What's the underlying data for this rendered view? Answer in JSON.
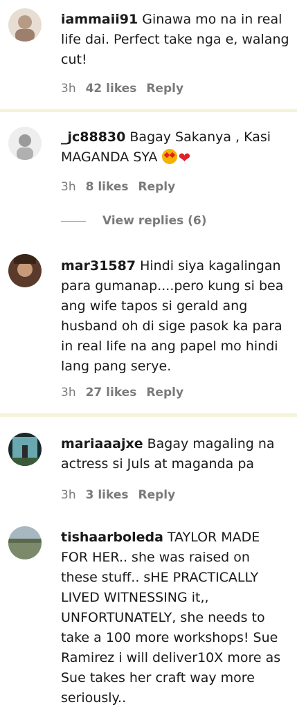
{
  "comments": [
    {
      "username": "iammaii91",
      "text": "Ginawa mo na in real life dai. Perfect take nga e, walang cut!",
      "time": "3h",
      "likes": "42 likes",
      "reply": "Reply",
      "avatar_color": "#b59a86"
    },
    {
      "username": "_jc88830",
      "text": "Bagay Sakanya , Kasi MAGANDA SYA",
      "emoji": "❤",
      "time": "3h",
      "likes": "8 likes",
      "reply": "Reply",
      "view_replies": "View replies (6)",
      "avatar_color": "#c9c9c9"
    },
    {
      "username": "mar31587",
      "text": "Hindi siya kagalingan para gumanap....pero kung si bea ang wife tapos si gerald ang husband oh di sige pasok ka para in real life na ang papel mo hindi lang pang serye.",
      "time": "3h",
      "likes": "27 likes",
      "reply": "Reply",
      "avatar_color": "#7a4f3a"
    },
    {
      "username": "mariaaajxe",
      "text": "Bagay magaling na actress si Juls at maganda pa",
      "time": "3h",
      "likes": "3 likes",
      "reply": "Reply",
      "avatar_color": "#4a7a6a"
    },
    {
      "username": "tishaarboleda",
      "text": "TAYLOR MADE FOR HER.. she was raised on these stuff.. sHE PRACTICALLY LIVED WITNESSING it,, UNFORTUNATELY, she needs to take a 100 more workshops! Sue Ramirez i will deliver10X more as Sue takes her craft way more seriously..",
      "avatar_color": "#8a9a7a"
    }
  ],
  "colors": {
    "separator": "#f5f3d8",
    "meta_text": "#7a7a7a"
  }
}
